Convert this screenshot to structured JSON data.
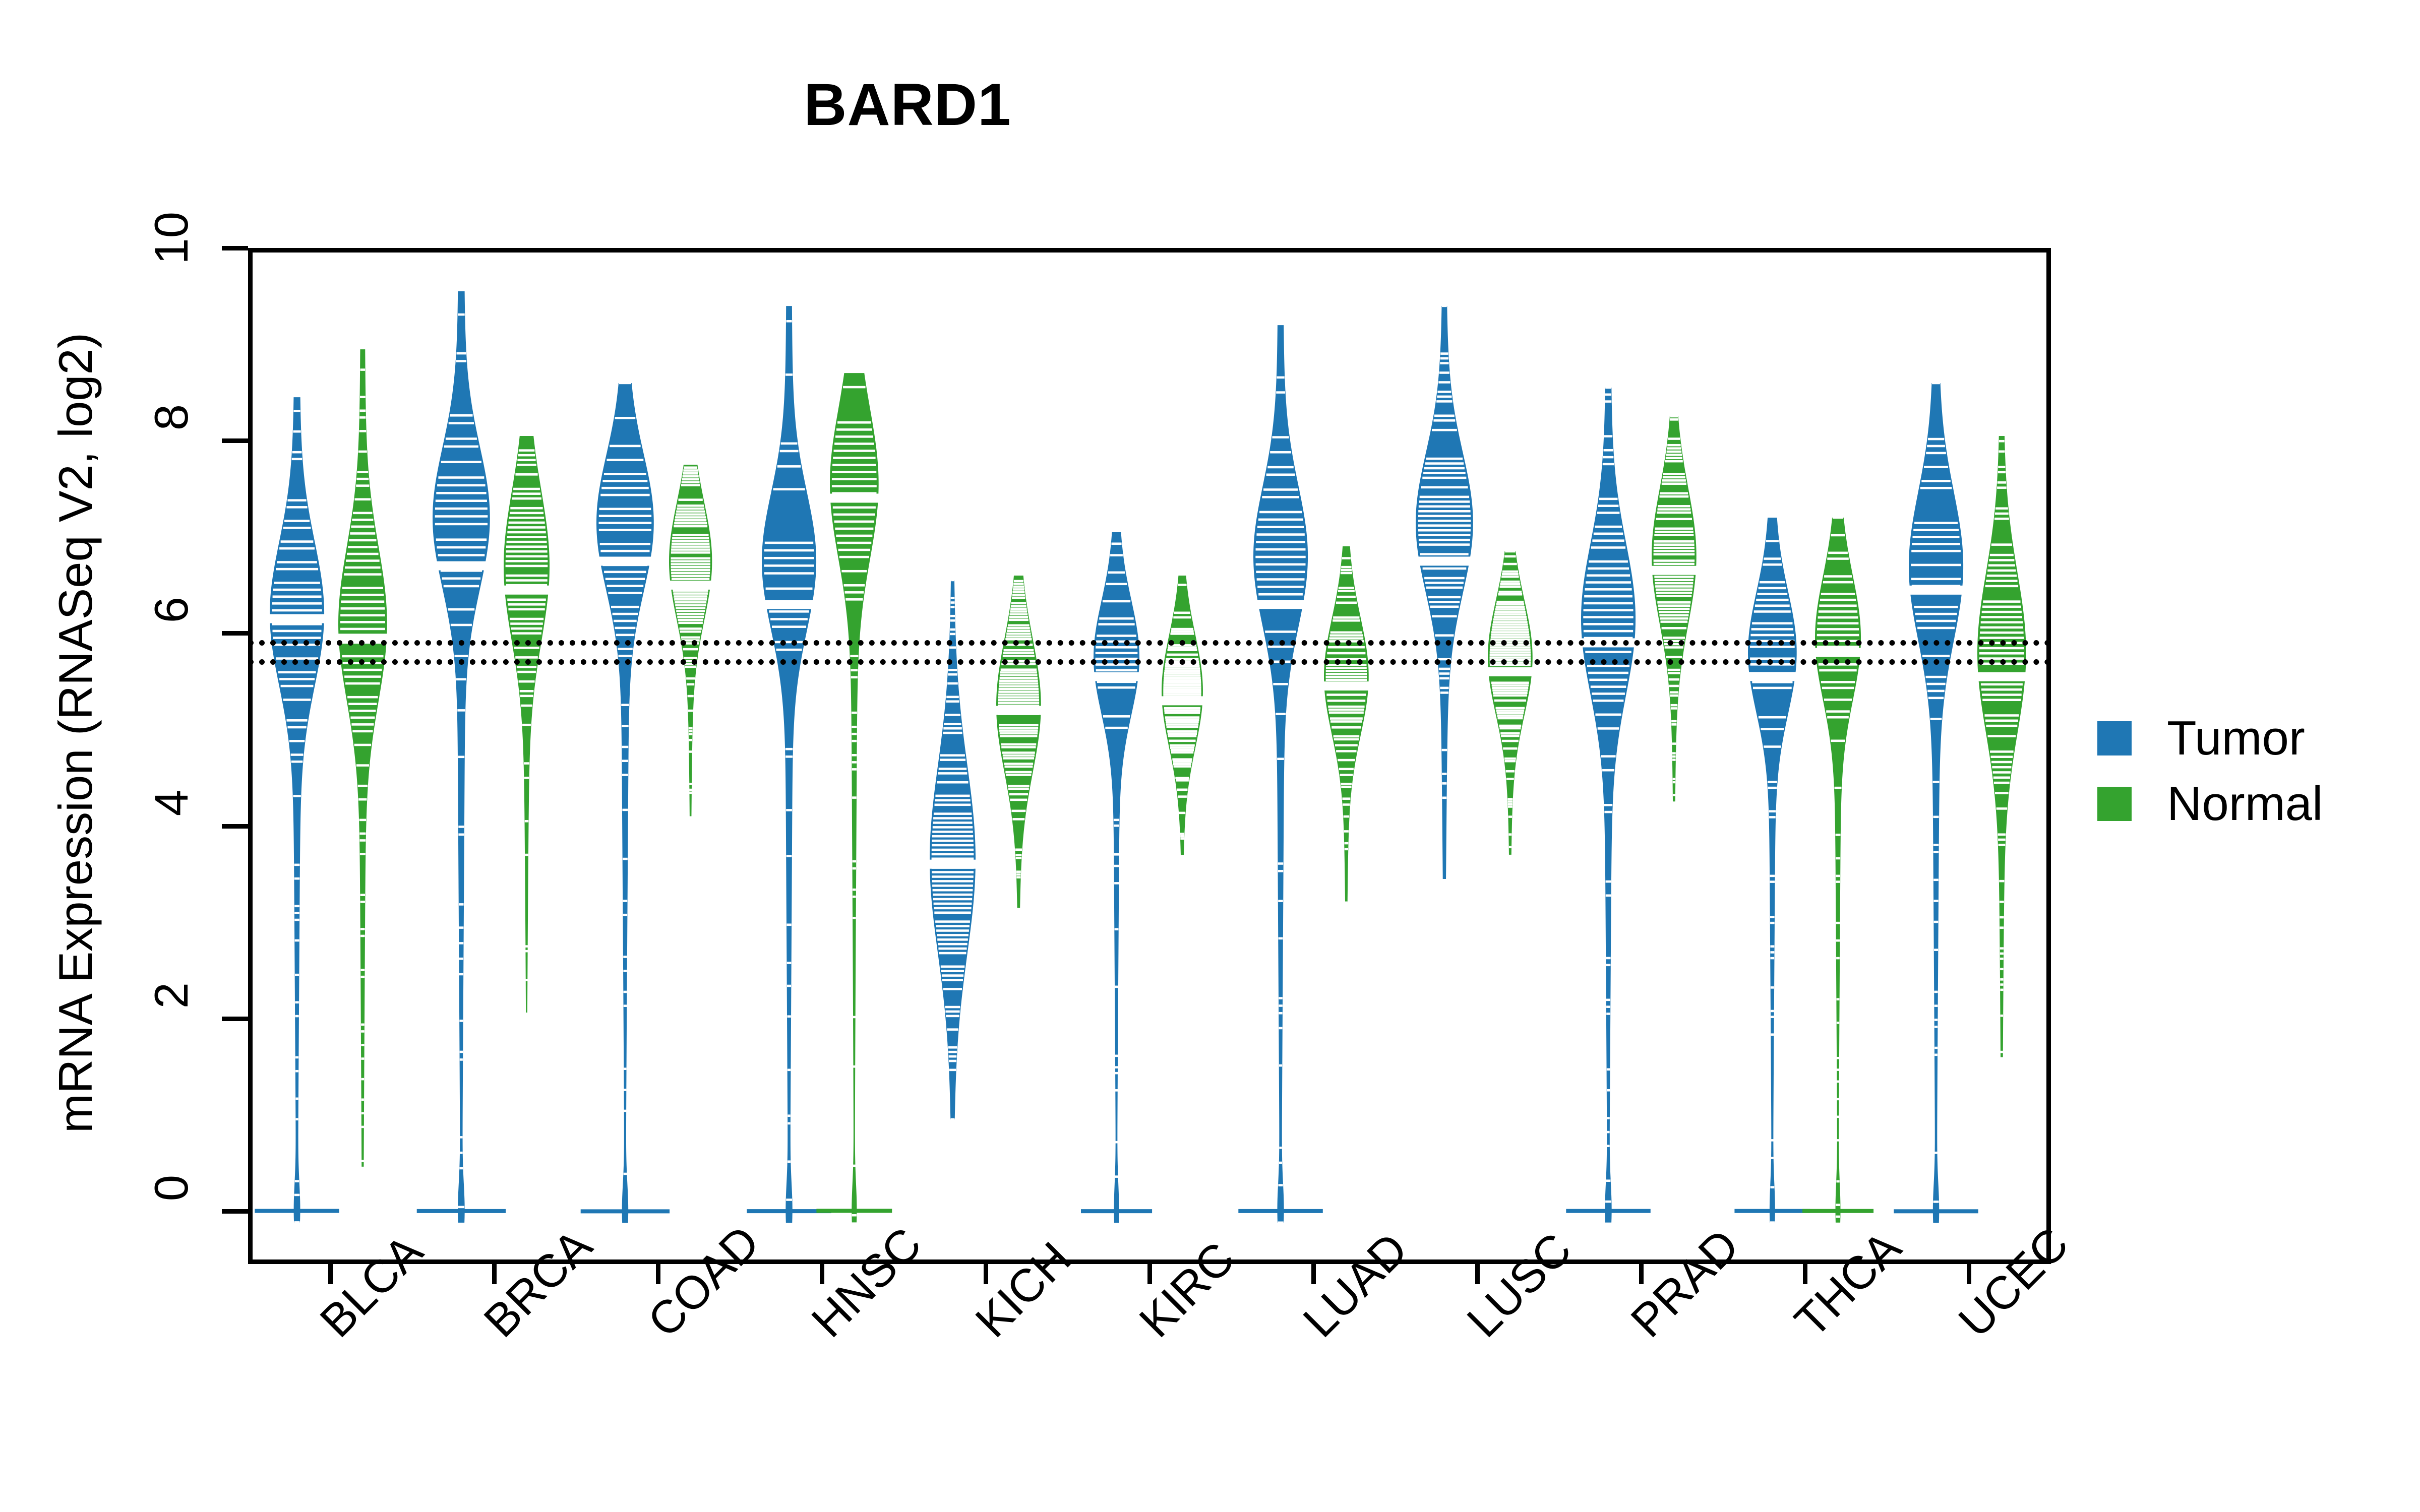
{
  "chart_data": {
    "type": "violin",
    "title": "BARD1",
    "xlabel": "",
    "ylabel": "mRNA Expression (RNASeq V2, log2)",
    "ylim": [
      -0.55,
      10.0
    ],
    "yticks": [
      0,
      2,
      4,
      6,
      8,
      10
    ],
    "ytick_labels": [
      "0",
      "2",
      "4",
      "6",
      "8",
      "10"
    ],
    "grid": false,
    "legend_position": "right",
    "colors": {
      "tumor": "#1f77b4",
      "normal": "#34a32f",
      "axis": "#000000",
      "background": "#ffffff"
    },
    "reference_lines": {
      "style": "dotted",
      "color": "#000000",
      "values": [
        5.93,
        5.73
      ]
    },
    "categories": [
      "BLCA",
      "BRCA",
      "COAD",
      "HNSC",
      "KICH",
      "KIRC",
      "LUAD",
      "LUSC",
      "PRAD",
      "THCA",
      "UCEC"
    ],
    "legend": [
      {
        "label": "Tumor",
        "color": "#1f77b4"
      },
      {
        "label": "Normal",
        "color": "#34a32f"
      }
    ],
    "series": [
      {
        "name": "Tumor",
        "color": "#1f77b4",
        "groups": [
          {
            "category": "BLCA",
            "median": 6.15,
            "q_low": 5.3,
            "q_high": 6.75,
            "min": 0.0,
            "max": 8.45,
            "body_low": 4.6,
            "body_high": 7.3,
            "peak": 6.2,
            "width": 0.95,
            "zero_floor": true
          },
          {
            "category": "BRCA",
            "median": 6.7,
            "q_low": 6.25,
            "q_high": 7.25,
            "min": 0.0,
            "max": 9.55,
            "body_low": 5.7,
            "body_high": 8.35,
            "peak": 7.2,
            "width": 1.0,
            "zero_floor": true
          },
          {
            "category": "COAD",
            "median": 6.75,
            "q_low": 6.3,
            "q_high": 7.3,
            "min": 0.0,
            "max": 8.6,
            "body_low": 5.55,
            "body_high": 8.1,
            "peak": 7.15,
            "width": 1.0,
            "zero_floor": true
          },
          {
            "category": "HNSC",
            "median": 6.3,
            "q_low": 5.85,
            "q_high": 6.9,
            "min": 0.0,
            "max": 9.4,
            "body_low": 5.3,
            "body_high": 7.9,
            "peak": 6.75,
            "width": 0.95,
            "zero_floor": true
          },
          {
            "category": "KICH",
            "median": 3.6,
            "q_low": 2.9,
            "q_high": 4.25,
            "min": 0.95,
            "max": 6.55,
            "body_low": 1.6,
            "body_high": 5.15,
            "peak": 3.65,
            "width": 0.8,
            "zero_floor": false
          },
          {
            "category": "KIRC",
            "median": 5.55,
            "q_low": 5.1,
            "q_high": 6.05,
            "min": 0.0,
            "max": 7.05,
            "body_low": 4.55,
            "body_high": 6.65,
            "peak": 5.75,
            "width": 0.8,
            "zero_floor": true
          },
          {
            "category": "LUAD",
            "median": 6.3,
            "q_low": 5.85,
            "q_high": 6.85,
            "min": 0.0,
            "max": 9.2,
            "body_low": 5.1,
            "body_high": 7.75,
            "peak": 6.8,
            "width": 0.95,
            "zero_floor": true
          },
          {
            "category": "LUSC",
            "median": 6.75,
            "q_low": 6.3,
            "q_high": 7.3,
            "min": 3.45,
            "max": 9.4,
            "body_low": 5.55,
            "body_high": 8.15,
            "peak": 7.15,
            "width": 1.0,
            "zero_floor": false
          },
          {
            "category": "PRAD",
            "median": 5.9,
            "q_low": 5.3,
            "q_high": 6.55,
            "min": 0.0,
            "max": 8.55,
            "body_low": 4.55,
            "body_high": 7.4,
            "peak": 6.15,
            "width": 0.95,
            "zero_floor": true
          },
          {
            "category": "THCA",
            "median": 5.55,
            "q_low": 5.05,
            "q_high": 6.05,
            "min": 0.0,
            "max": 7.2,
            "body_low": 4.45,
            "body_high": 6.7,
            "peak": 5.8,
            "width": 0.85,
            "zero_floor": true
          },
          {
            "category": "UCEC",
            "median": 6.45,
            "q_low": 5.85,
            "q_high": 7.1,
            "min": 0.0,
            "max": 8.6,
            "body_low": 5.1,
            "body_high": 7.9,
            "peak": 6.7,
            "width": 0.95,
            "zero_floor": true
          }
        ]
      },
      {
        "name": "Normal",
        "color": "#34a32f",
        "groups": [
          {
            "category": "BLCA",
            "median": 5.95,
            "q_low": 5.45,
            "q_high": 6.45,
            "min": 0.45,
            "max": 8.95,
            "body_low": 4.2,
            "body_high": 7.1,
            "peak": 6.1,
            "width": 0.85,
            "zero_floor": false
          },
          {
            "category": "BRCA",
            "median": 6.45,
            "q_low": 6.05,
            "q_high": 6.9,
            "min": 2.05,
            "max": 8.05,
            "body_low": 4.65,
            "body_high": 7.45,
            "peak": 6.7,
            "width": 0.8,
            "zero_floor": false
          },
          {
            "category": "COAD",
            "median": 6.5,
            "q_low": 6.1,
            "q_high": 6.95,
            "min": 4.1,
            "max": 7.75,
            "body_low": 5.25,
            "body_high": 7.4,
            "peak": 6.75,
            "width": 0.75,
            "zero_floor": false
          },
          {
            "category": "HNSC",
            "median": 7.4,
            "q_low": 7.0,
            "q_high": 7.85,
            "min": 0.0,
            "max": 8.7,
            "body_low": 5.6,
            "body_high": 8.4,
            "peak": 7.55,
            "width": 0.85,
            "zero_floor": true
          },
          {
            "category": "KICH",
            "median": 5.2,
            "q_low": 4.7,
            "q_high": 5.7,
            "min": 3.15,
            "max": 6.6,
            "body_low": 3.9,
            "body_high": 6.35,
            "peak": 5.25,
            "width": 0.78,
            "zero_floor": false
          },
          {
            "category": "KIRC",
            "median": 5.3,
            "q_low": 4.9,
            "q_high": 5.75,
            "min": 3.7,
            "max": 6.6,
            "body_low": 4.25,
            "body_high": 6.3,
            "peak": 5.4,
            "width": 0.72,
            "zero_floor": false
          },
          {
            "category": "LUAD",
            "median": 5.45,
            "q_low": 5.05,
            "q_high": 5.9,
            "min": 3.2,
            "max": 6.9,
            "body_low": 4.35,
            "body_high": 6.5,
            "peak": 5.55,
            "width": 0.78,
            "zero_floor": false
          },
          {
            "category": "LUSC",
            "median": 5.6,
            "q_low": 5.2,
            "q_high": 6.05,
            "min": 3.7,
            "max": 6.85,
            "body_low": 4.45,
            "body_high": 6.55,
            "peak": 5.75,
            "width": 0.78,
            "zero_floor": false
          },
          {
            "category": "PRAD",
            "median": 6.65,
            "q_low": 6.25,
            "q_high": 7.05,
            "min": 4.25,
            "max": 8.25,
            "body_low": 5.2,
            "body_high": 7.7,
            "peak": 6.8,
            "width": 0.78,
            "zero_floor": false
          },
          {
            "category": "THCA",
            "median": 5.8,
            "q_low": 5.35,
            "q_high": 6.25,
            "min": 0.0,
            "max": 7.2,
            "body_low": 4.55,
            "body_high": 6.85,
            "peak": 5.95,
            "width": 0.8,
            "zero_floor": true
          },
          {
            "category": "UCEC",
            "median": 5.55,
            "q_low": 4.95,
            "q_high": 6.1,
            "min": 1.6,
            "max": 8.05,
            "body_low": 4.05,
            "body_high": 7.05,
            "peak": 5.8,
            "width": 0.85,
            "zero_floor": false
          }
        ]
      }
    ]
  }
}
